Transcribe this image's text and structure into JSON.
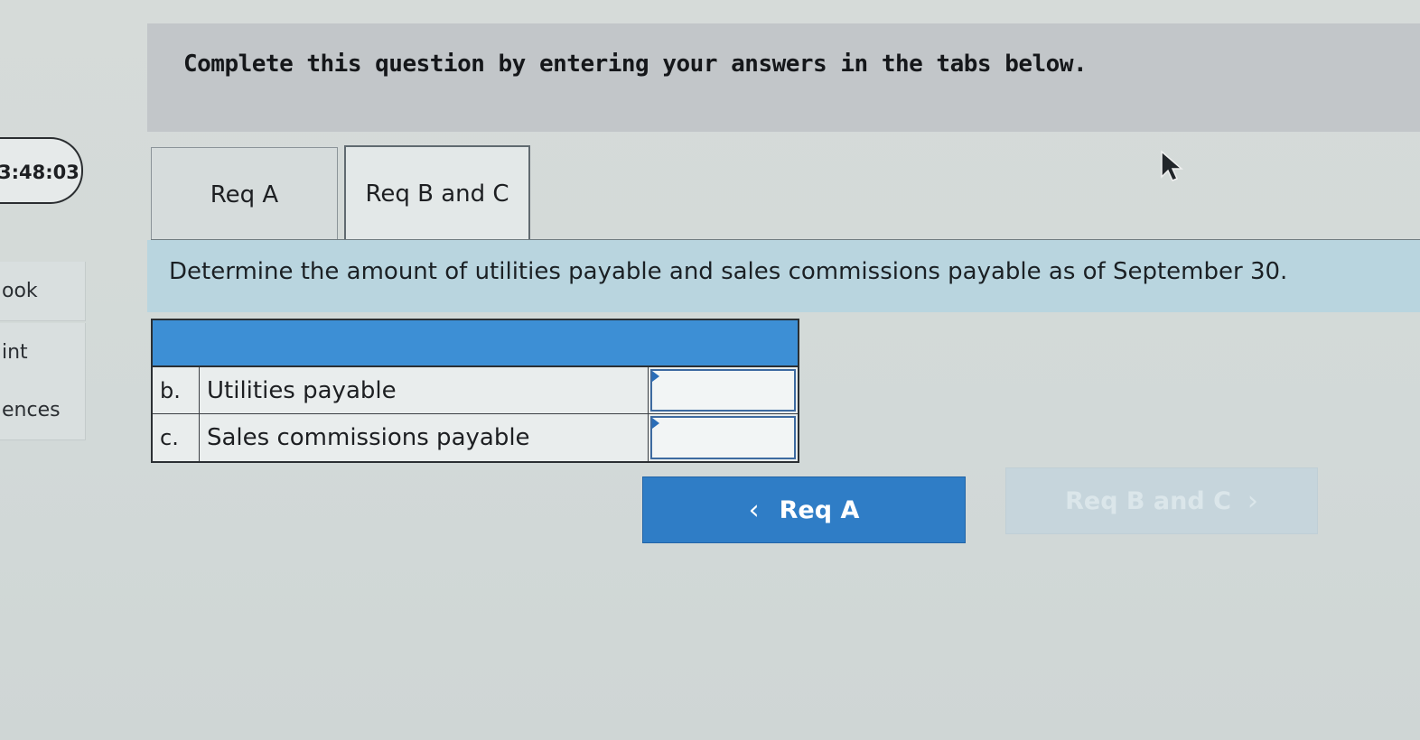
{
  "sidebar": {
    "timer": "3:48:03",
    "items": [
      {
        "label": "ook"
      },
      {
        "label": "int"
      },
      {
        "label": "ences"
      }
    ]
  },
  "instruction": "Complete this question by entering your answers in the tabs below.",
  "tabs": [
    {
      "label": "Req A",
      "active": false
    },
    {
      "label": "Req B and C",
      "active": true
    }
  ],
  "prompt": "Determine the amount of utilities payable and sales commissions payable as of September 30.",
  "table": {
    "rows": [
      {
        "letter": "b.",
        "label": "Utilities payable",
        "value": ""
      },
      {
        "letter": "c.",
        "label": "Sales commissions payable",
        "value": ""
      }
    ]
  },
  "nav": {
    "prev_label": "Req A",
    "next_label": "Req B and C"
  },
  "colors": {
    "accent": "#2f7dc6",
    "table_header": "#3d8fd5",
    "prompt_strip": "#b9d5df"
  }
}
